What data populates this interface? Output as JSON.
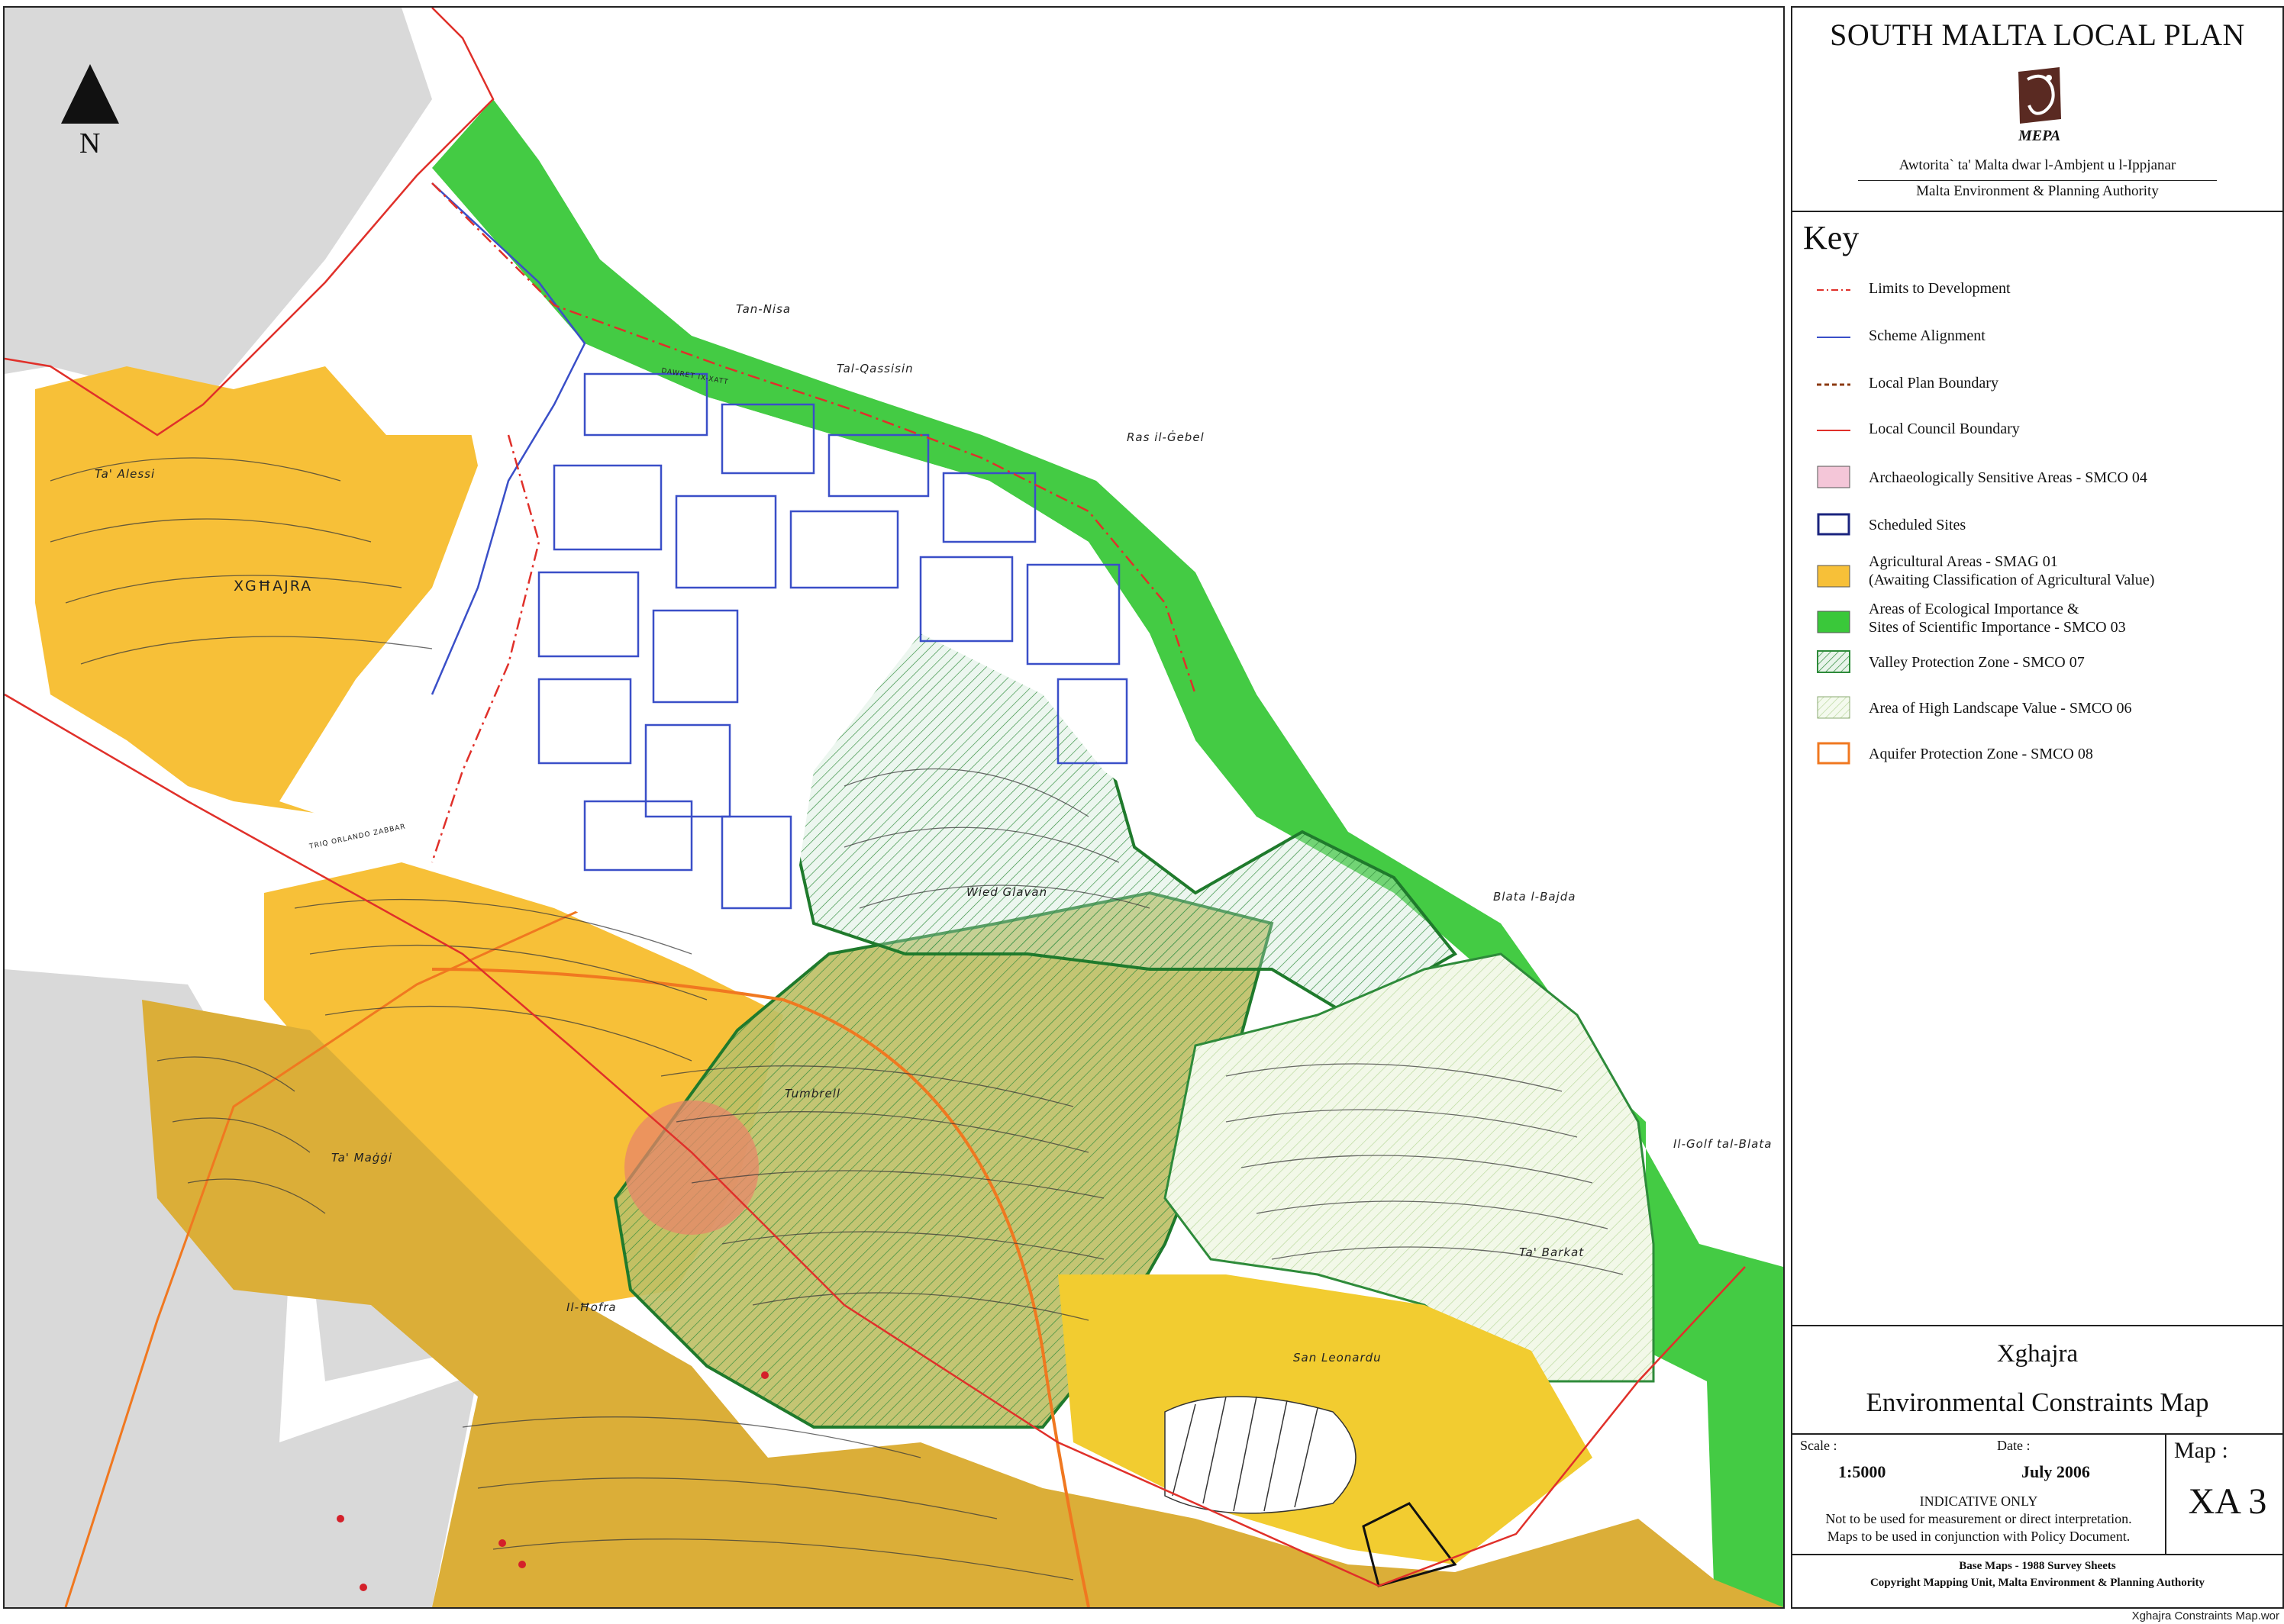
{
  "panel": {
    "plan_title": "SOUTH MALTA LOCAL PLAN",
    "logo_text": "MEPA",
    "authority_mt": "Awtorita` ta' Malta dwar l-Ambjent u l-Ippjanar",
    "authority_en": "Malta Environment & Planning Authority",
    "key_title": "Key",
    "legend": [
      {
        "label": "Limits to Development",
        "symbol": "line-dashdot",
        "color": "#e0302a"
      },
      {
        "label": "Scheme Alignment",
        "symbol": "line",
        "color": "#3a4fc8"
      },
      {
        "label": "Local Plan Boundary",
        "symbol": "line-dashed",
        "color": "#8b3a10"
      },
      {
        "label": "Local Council Boundary",
        "symbol": "line",
        "color": "#e0302a"
      },
      {
        "label": "Archaeologically Sensitive Areas - SMCO 04",
        "symbol": "fill",
        "color": "#f4c6d8"
      },
      {
        "label": "Scheduled Sites",
        "symbol": "outline",
        "color": "#1a237e"
      },
      {
        "label": "Agricultural Areas - SMAG 01",
        "label2": "(Awaiting Classification of Agricultural Value)",
        "symbol": "fill",
        "color": "#f7c038"
      },
      {
        "label": "Areas of Ecological Importance &",
        "label2": "Sites of Scientific Importance - SMCO 03",
        "symbol": "fill",
        "color": "#3ac83a"
      },
      {
        "label": "Valley Protection Zone - SMCO 07",
        "symbol": "hatch-green",
        "color": "#2e8b3a"
      },
      {
        "label": "Area of High Landscape Value - SMCO 06",
        "symbol": "hatch-light",
        "color": "#cfe8b0"
      },
      {
        "label": "Aquifer Protection Zone - SMCO 08",
        "symbol": "outline",
        "color": "#f07820"
      }
    ],
    "map_place": "Xghajra",
    "map_subject": "Environmental Constraints Map",
    "scale_label": "Scale :",
    "scale_value": "1:5000",
    "date_label": "Date :",
    "date_value": "July 2006",
    "indicative_lines": [
      "INDICATIVE ONLY",
      "Not to be used for measurement or direct interpretation.",
      "Maps to be used in conjunction with Policy Document."
    ],
    "map_no_label": "Map :",
    "map_no_value": "XA 3",
    "credits_1": "Base Maps - 1988 Survey Sheets",
    "credits_2": "Copyright Mapping Unit, Malta Environment & Planning Authority"
  },
  "map": {
    "north_label": "N",
    "places": {
      "tan_nisa": "Tan-Nisa",
      "tal_qassisin": "Tal-Qassisin",
      "ras_il_gebel": "Ras il-Ġebel",
      "ta_alessi": "Ta' Alessi",
      "xghajra": "XGĦAJRA",
      "blata_l_bajda": "Blata l-Bajda",
      "wied_glavan": "Wied Glavan",
      "il_golf_tal_blata": "Il-Golf tal-Blata",
      "tumbrell": "Tumbrell",
      "ta_maggi": "Ta' Maġġi",
      "ta_barkat": "Ta' Barkat",
      "il_hofra": "Il-Ħofra",
      "san_leonardu": "San Leonardu"
    },
    "roads": {
      "triq_orlando_zabbar": "TRIQ ORLANDO ZABBAR",
      "dawret_ix_xatt": "DAWRET IX-XATT"
    }
  },
  "file_name": "Xghajra Constraints Map.wor"
}
